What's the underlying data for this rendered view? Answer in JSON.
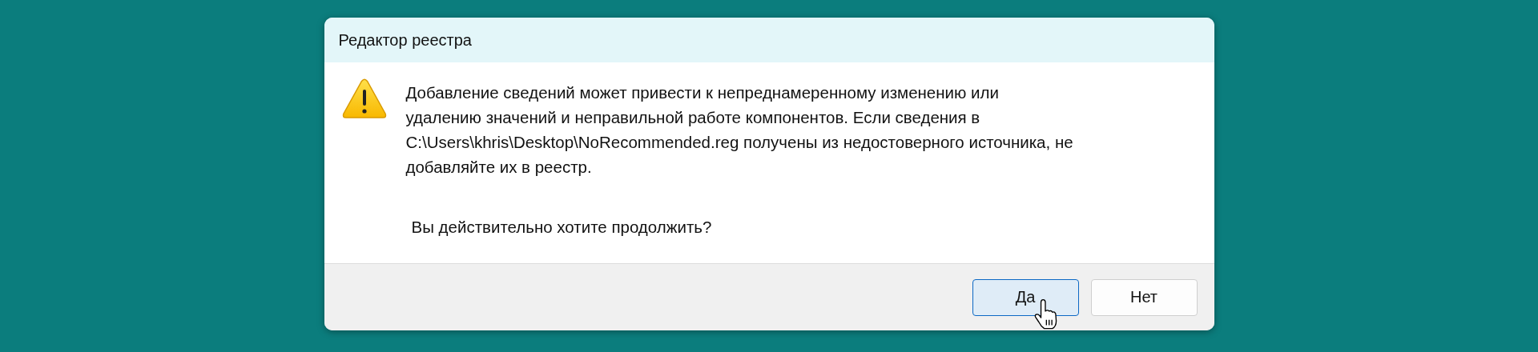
{
  "window": {
    "title": "Редактор реестра"
  },
  "message": {
    "lines": [
      "Добавление сведений может привести к непреднамеренному изменению или",
      "удалению значений и неправильной работе компонентов. Если сведения в",
      "C:\\Users\\khris\\Desktop\\NoRecommended.reg получены из недостоверного источника, не",
      "добавляйте их в реестр."
    ],
    "question": "Вы действительно хотите продолжить?"
  },
  "buttons": [
    {
      "label": "Да",
      "default": true
    },
    {
      "label": "Нет",
      "default": false
    }
  ]
}
